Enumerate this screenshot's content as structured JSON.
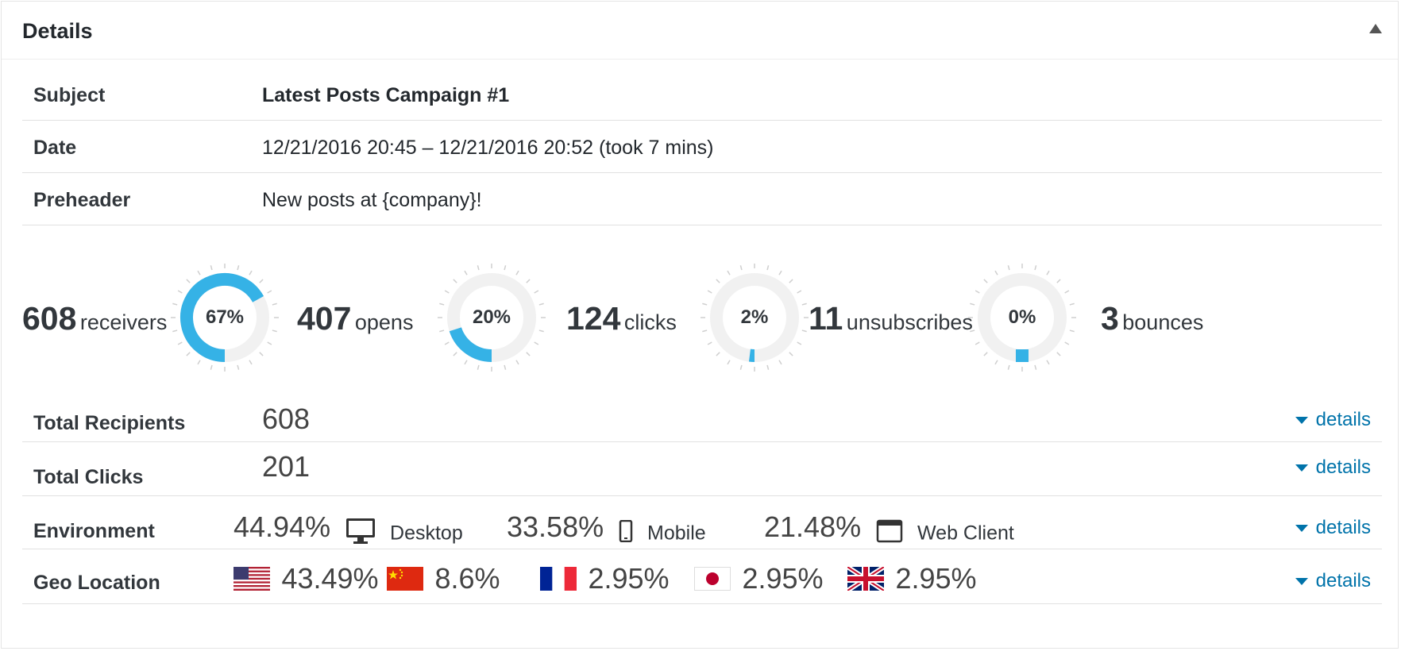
{
  "panel": {
    "title": "Details"
  },
  "rows": {
    "subject": {
      "label": "Subject",
      "value": "Latest Posts Campaign #1"
    },
    "date": {
      "label": "Date",
      "value": "12/21/2016 20:45 – 12/21/2016 20:52 (took 7 mins)"
    },
    "preheader": {
      "label": "Preheader",
      "value": "New posts at {company}!"
    }
  },
  "stats": {
    "receivers": {
      "num": "608",
      "label": "receivers"
    },
    "opens": {
      "num": "407",
      "label": "opens"
    },
    "clicks": {
      "num": "124",
      "label": "clicks"
    },
    "unsubscribes": {
      "num": "11",
      "label": "unsubscribes"
    },
    "bounces": {
      "num": "3",
      "label": "bounces"
    },
    "donuts": [
      {
        "text": "67%",
        "fraction": 0.67
      },
      {
        "text": "20%",
        "fraction": 0.2
      },
      {
        "text": "2%",
        "fraction": 0.02
      },
      {
        "text": "0%",
        "fraction": 0.0
      }
    ]
  },
  "summary": {
    "total_recipients": {
      "label": "Total Recipients",
      "value": "608"
    },
    "total_clicks": {
      "label": "Total Clicks",
      "value": "201"
    },
    "environment": {
      "label": "Environment",
      "items": [
        {
          "percent": "44.94%",
          "name": "Desktop",
          "icon": "desktop-icon"
        },
        {
          "percent": "33.58%",
          "name": "Mobile",
          "icon": "mobile-icon"
        },
        {
          "percent": "21.48%",
          "name": "Web Client",
          "icon": "web-client-icon"
        }
      ]
    },
    "geo": {
      "label": "Geo Location",
      "items": [
        {
          "percent": "43.49%",
          "flag": "us-flag-icon"
        },
        {
          "percent": "8.6%",
          "flag": "china-flag-icon"
        },
        {
          "percent": "2.95%",
          "flag": "france-flag-icon"
        },
        {
          "percent": "2.95%",
          "flag": "japan-flag-icon"
        },
        {
          "percent": "2.95%",
          "flag": "uk-flag-icon"
        }
      ]
    },
    "details_link": "details"
  },
  "colors": {
    "accent": "#35b2e6",
    "track": "#f1f1f1",
    "link": "#0073aa"
  }
}
